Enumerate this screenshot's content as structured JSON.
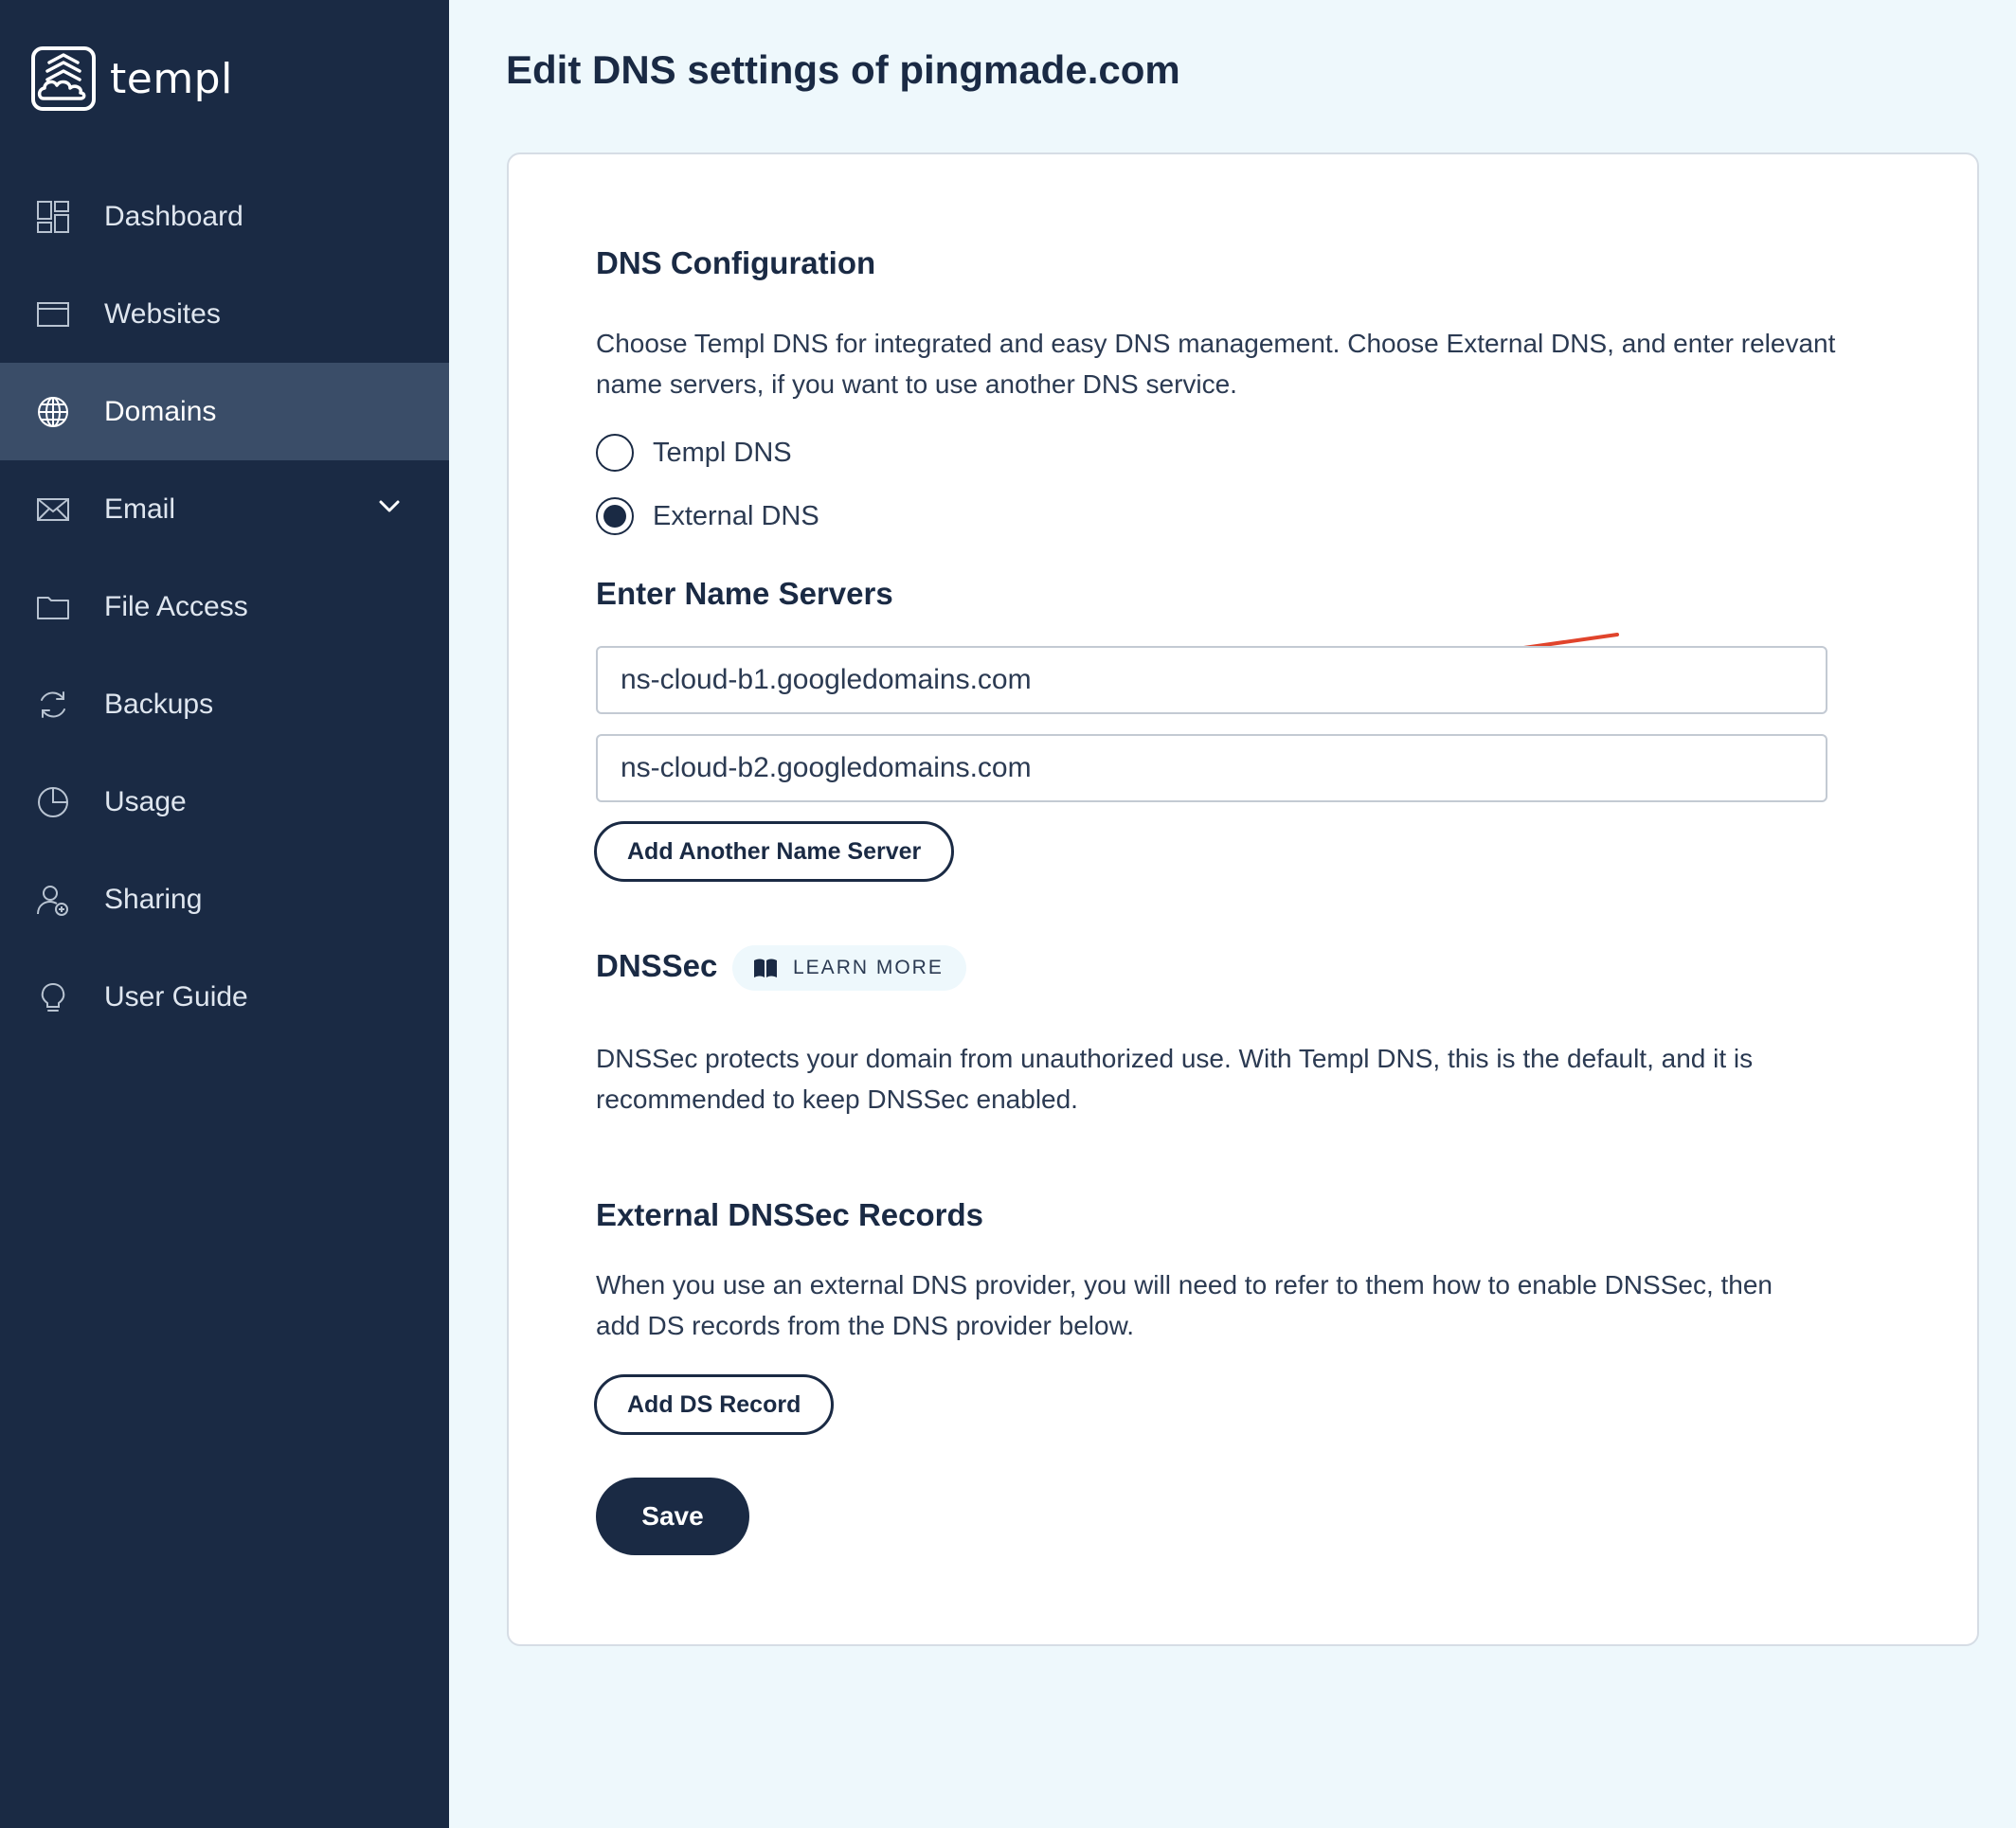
{
  "app": {
    "logo_text": "templ"
  },
  "sidebar": {
    "items": [
      {
        "label": "Dashboard",
        "icon": "dashboard-icon"
      },
      {
        "label": "Websites",
        "icon": "browser-window-icon"
      },
      {
        "label": "Domains",
        "icon": "globe-icon",
        "active": true
      },
      {
        "label": "Email",
        "icon": "envelope-icon",
        "has_submenu": true
      },
      {
        "label": "File Access",
        "icon": "folder-icon"
      },
      {
        "label": "Backups",
        "icon": "refresh-icon"
      },
      {
        "label": "Usage",
        "icon": "pie-chart-icon"
      },
      {
        "label": "Sharing",
        "icon": "user-add-icon"
      },
      {
        "label": "User Guide",
        "icon": "lightbulb-icon"
      }
    ]
  },
  "page": {
    "title": "Edit DNS settings of pingmade.com"
  },
  "dns_config": {
    "title": "DNS Configuration",
    "description_line1": "Choose Templ DNS for integrated and easy DNS management. Choose External DNS, and enter relevant",
    "description_line2": "name servers, if you want to use another DNS service.",
    "options": [
      {
        "label": "Templ DNS",
        "selected": false
      },
      {
        "label": "External DNS",
        "selected": true
      }
    ]
  },
  "name_servers": {
    "title": "Enter Name Servers",
    "values": [
      "ns-cloud-b1.googledomains.com",
      "ns-cloud-b2.googledomains.com"
    ],
    "add_button": "Add Another Name Server"
  },
  "dnssec": {
    "title": "DNSSec",
    "learn_more": "LEARN MORE",
    "description_line1": "DNSSec protects your domain from unauthorized use. With Templ DNS, this is the default, and it is",
    "description_line2": "recommended to keep DNSSec enabled."
  },
  "external_dnssec": {
    "title": "External DNSSec Records",
    "description_line1": "When you use an external DNS provider, you will need to refer to them how to enable DNSSec, then",
    "description_line2": "add DS records from the DNS provider below.",
    "add_button": "Add DS Record"
  },
  "actions": {
    "save": "Save"
  },
  "colors": {
    "sidebar_bg": "#1a2a44",
    "sidebar_active": "#3a4d68",
    "page_bg": "#eef8fc",
    "accent": "#1a2a44",
    "annotation_arrow": "#e0442c"
  }
}
